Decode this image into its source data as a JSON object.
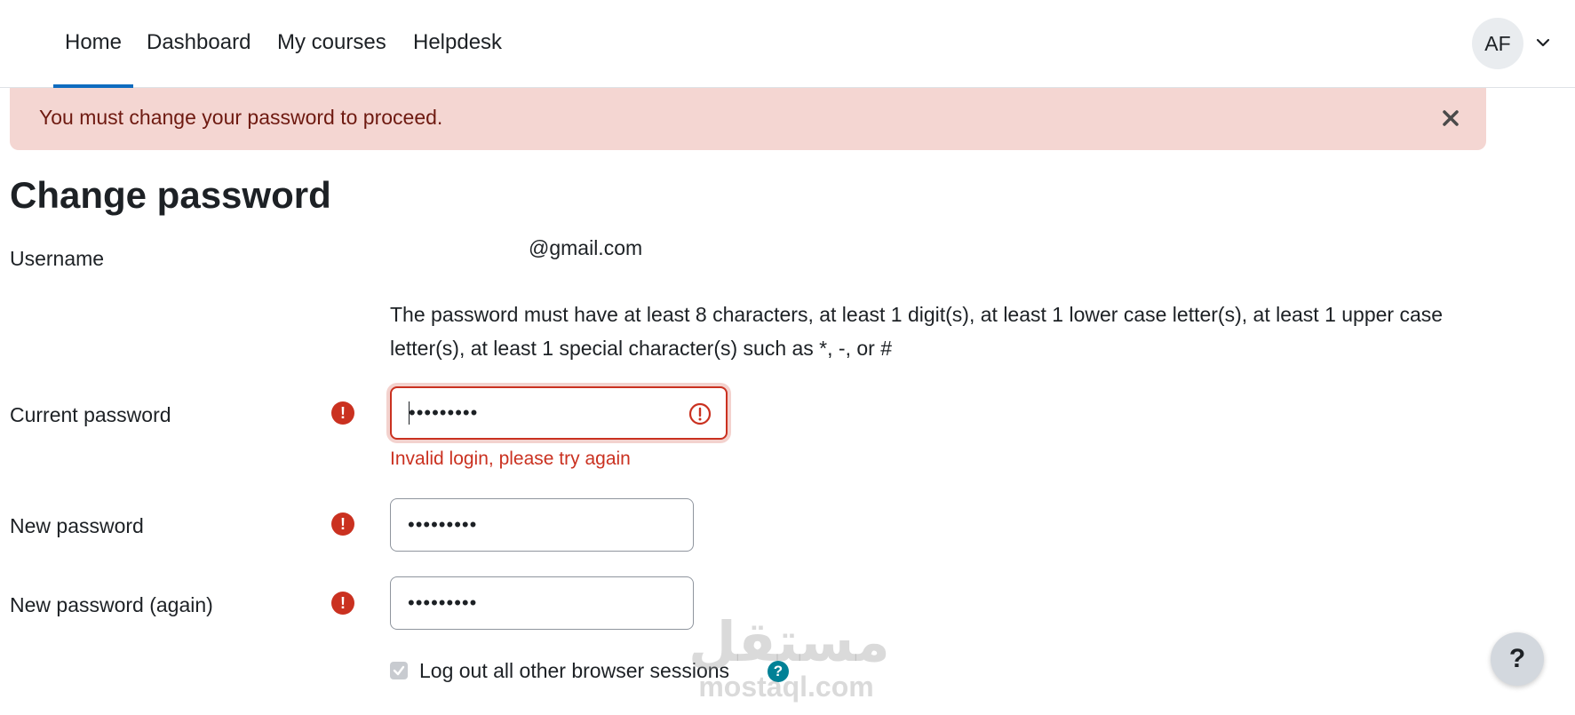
{
  "nav": {
    "items": [
      {
        "label": "Home"
      },
      {
        "label": "Dashboard"
      },
      {
        "label": "My courses"
      },
      {
        "label": "Helpdesk"
      }
    ],
    "user_initials": "AF"
  },
  "alert": {
    "message": "You must change your password to proceed.",
    "close_icon": "close-icon",
    "color": "#f4d6d2"
  },
  "page": {
    "title": "Change password"
  },
  "form": {
    "username_label": "Username",
    "username_value": "@gmail.com",
    "policy_text": "The password must have at least 8 characters, at least 1 digit(s), at least 1 lower case letter(s), at least 1 upper case letter(s), at least 1 special character(s) such as *, -, or #",
    "current_password": {
      "label": "Current password",
      "value": "•••••••••",
      "error": "Invalid login, please try again"
    },
    "new_password": {
      "label": "New password",
      "value": "•••••••••"
    },
    "new_password_again": {
      "label": "New password (again)",
      "value": "•••••••••"
    },
    "logout_sessions": {
      "label": "Log out all other browser sessions",
      "checked": true
    },
    "required_icon_glyph": "!",
    "help_icon_glyph": "?"
  },
  "watermark": {
    "arabic": "مستقل",
    "latin": "mostaql.com"
  },
  "help_fab": {
    "glyph": "?"
  },
  "colors": {
    "accent": "#0f6cbf",
    "error": "#ca3120",
    "help": "#008196"
  }
}
